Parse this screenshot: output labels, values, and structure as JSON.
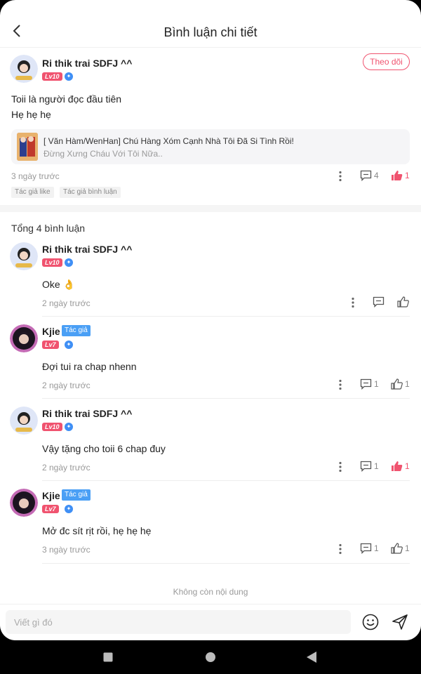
{
  "header": {
    "title": "Bình luận chi tiết"
  },
  "main_comment": {
    "username": "Ri thik trai SDFJ ^^",
    "level": "Lv10",
    "follow_label": "Theo dõi",
    "lines": [
      "Toii là người đọc đầu tiên",
      "Hẹ hẹ hẹ"
    ],
    "book": {
      "title": "[ Văn Hàm/WenHan] Chú Hàng Xóm Cạnh Nhà Tôi Đã Si Tình Rồi!",
      "subtitle": "Đừng Xưng Cháu Với Tôi Nữa.."
    },
    "time": "3 ngày trước",
    "reply_count": "4",
    "like_count": "1",
    "tags": [
      "Tác giả like",
      "Tác giả bình luận"
    ]
  },
  "total_label": "Tổng 4 bình luận",
  "replies": [
    {
      "username": "Ri thik trai SDFJ ^^",
      "level": "Lv10",
      "author_tag": "",
      "text": "Oke 👌",
      "time": "2 ngày trước",
      "reply_count": "",
      "like_count": "",
      "liked": false
    },
    {
      "username": "Kjie",
      "level": "Lv7",
      "author_tag": "Tác giả",
      "text": "Đợi tui ra chap nhenn",
      "time": "2 ngày trước",
      "reply_count": "1",
      "like_count": "1",
      "liked": false
    },
    {
      "username": "Ri thik trai SDFJ ^^",
      "level": "Lv10",
      "author_tag": "",
      "text": "Vậy tặng cho toii 6 chap đuy",
      "time": "2 ngày trước",
      "reply_count": "1",
      "like_count": "1",
      "liked": true
    },
    {
      "username": "Kjie",
      "level": "Lv7",
      "author_tag": "Tác giả",
      "text": "Mở đc sít rịt rồi, hẹ hẹ hẹ",
      "time": "3 ngày trước",
      "reply_count": "1",
      "like_count": "1",
      "liked": false
    }
  ],
  "footer": {
    "no_more": "Không còn nội dung",
    "input_placeholder": "Viết gì đó"
  },
  "colors": {
    "accent": "#f0536f",
    "badge_blue": "#4a9ff5"
  }
}
